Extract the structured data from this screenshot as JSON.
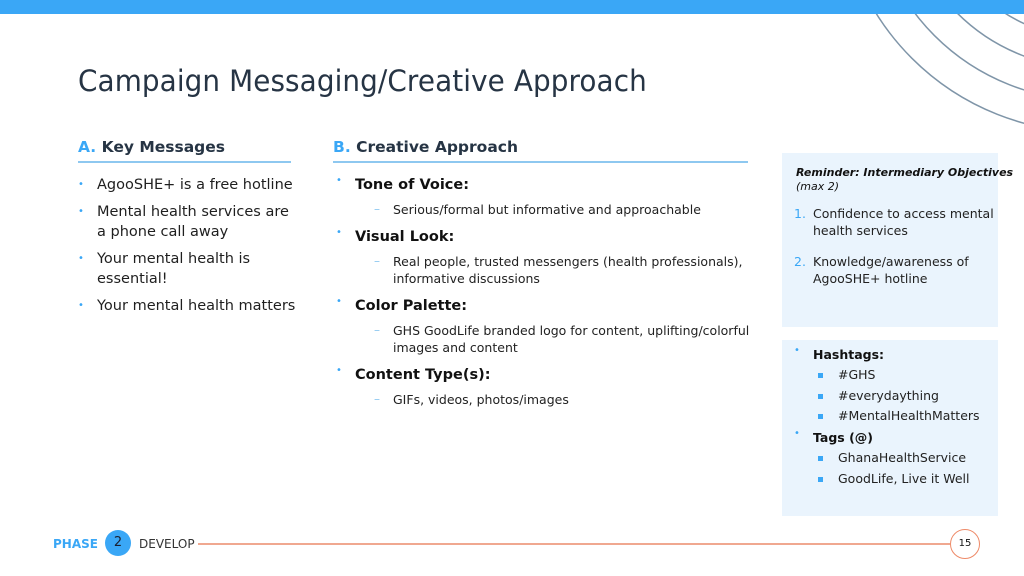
{
  "colors": {
    "accent": "#3aa7f6",
    "title": "#263444",
    "panel_bg": "#eaf4fd",
    "footer_line": "#f0a890"
  },
  "title": "Campaign Messaging/Creative Approach",
  "section_a": {
    "letter": "A.",
    "heading": "Key Messages",
    "items": [
      "AgooSHE+ is a free hotline",
      "Mental health services are a phone call away",
      "Your mental health is essential!",
      "Your mental health matters"
    ]
  },
  "section_b": {
    "letter": "B.",
    "heading": "Creative Approach",
    "items": [
      {
        "label": "Tone of Voice:",
        "detail": "Serious/formal but informative and approachable"
      },
      {
        "label": "Visual Look:",
        "detail": "Real people, trusted messengers (health professionals), informative discussions"
      },
      {
        "label": "Color Palette:",
        "detail": "GHS GoodLife branded logo for content, uplifting/colorful images and content"
      },
      {
        "label": "Content Type(s):",
        "detail": "GIFs, videos, photos/images"
      }
    ]
  },
  "objectives_panel": {
    "title": "Reminder: Intermediary Objectives",
    "subtitle": "(max 2)",
    "items": [
      {
        "num": "1.",
        "text": "Confidence to access mental health services"
      },
      {
        "num": "2.",
        "text": "Knowledge/awareness of AgooSHE+ hotline"
      }
    ]
  },
  "tags_panel": {
    "hashtags_label": "Hashtags:",
    "hashtags": [
      "#GHS",
      "#everydaything",
      "#MentalHealthMatters"
    ],
    "tags_label": "Tags (@)",
    "tags": [
      "GhanaHealthService",
      "GoodLife, Live it Well"
    ]
  },
  "footer": {
    "phase_label": "PHASE",
    "phase_number": "2",
    "phase_name": "DEVELOP",
    "page_number": "15"
  },
  "icons": {
    "bullet": "•",
    "dash": "–"
  }
}
